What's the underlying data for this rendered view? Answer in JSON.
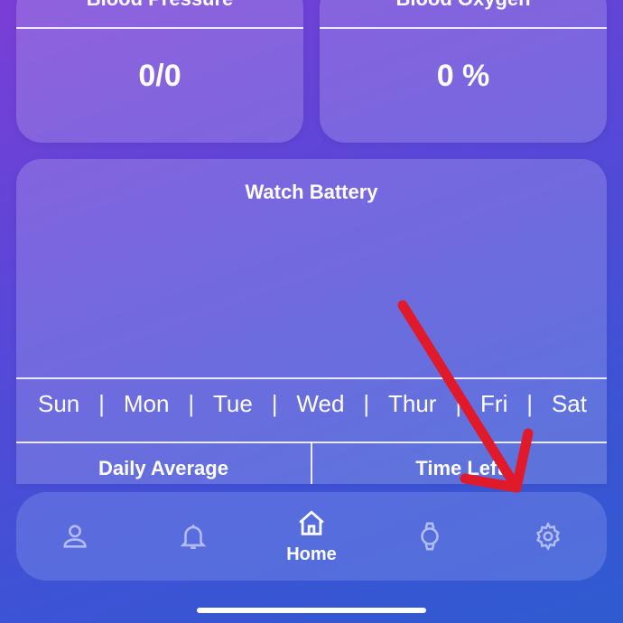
{
  "metrics": {
    "blood_pressure": {
      "title": "Blood Pressure",
      "value": "0/0"
    },
    "blood_oxygen": {
      "title": "Blood Oxygen",
      "value": "0 %"
    }
  },
  "battery": {
    "title": "Watch Battery",
    "days": [
      "Sun",
      "Mon",
      "Tue",
      "Wed",
      "Thur",
      "Fri",
      "Sat"
    ],
    "bottom_left": "Daily Average",
    "bottom_right": "Time Left"
  },
  "nav": {
    "items": [
      {
        "icon": "user-icon",
        "label": ""
      },
      {
        "icon": "bell-icon",
        "label": ""
      },
      {
        "icon": "home-icon",
        "label": "Home"
      },
      {
        "icon": "watch-icon",
        "label": ""
      },
      {
        "icon": "gear-icon",
        "label": ""
      }
    ]
  },
  "colors": {
    "gradient_start": "#7a3ed6",
    "gradient_end": "#2f5bd0",
    "arrow": "#e0192b"
  }
}
